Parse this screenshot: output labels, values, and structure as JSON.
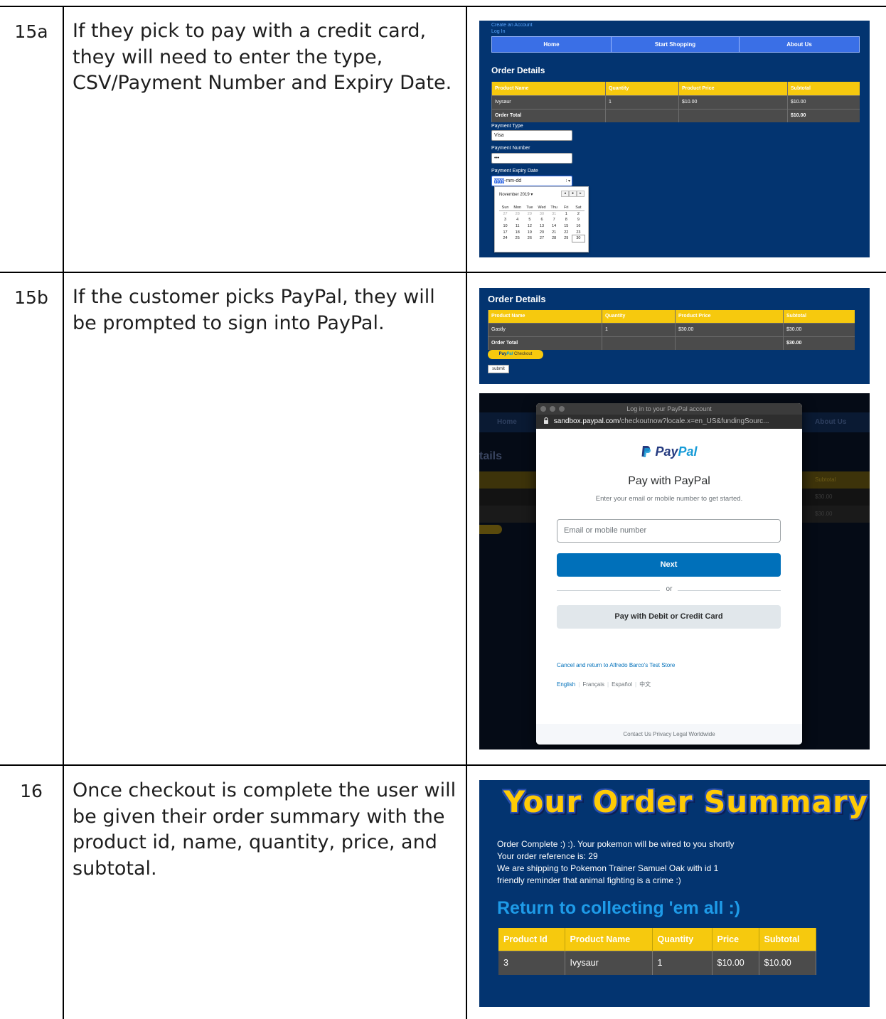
{
  "rows": [
    {
      "num": "15a",
      "text": "If they pick to pay with a credit card, they will need to enter the type, CSV/Payment Number and Expiry Date."
    },
    {
      "num": "15b",
      "text": "If the customer picks PayPal, they will be prompted to sign into PayPal."
    },
    {
      "num": "16",
      "text": "Once checkout is complete the user will be given their order summary with the product id, name, quantity, price, and subtotal."
    }
  ],
  "shot_a": {
    "links": [
      "Create an Account",
      "Log In"
    ],
    "nav": [
      "Home",
      "Start Shopping",
      "About Us"
    ],
    "title": "Order Details",
    "table": {
      "headers": [
        "Product Name",
        "Quantity",
        "Product Price",
        "Subtotal"
      ],
      "row": [
        "Ivysaur",
        "1",
        "$10.00",
        "$10.00"
      ],
      "total_label": "Order Total",
      "total_value": "$10.00"
    },
    "payment_type_label": "Payment Type",
    "payment_type_value": "Visa",
    "payment_number_label": "Payment Number",
    "payment_number_value": "•••",
    "expiry_label": "Payment Expiry Date",
    "expiry_sel": "yyyy",
    "expiry_rest": "-mm-dd",
    "calendar": {
      "month": "November 2019 ▾",
      "dow": [
        "Sun",
        "Mon",
        "Tue",
        "Wed",
        "Thu",
        "Fri",
        "Sat"
      ],
      "weeks": [
        [
          "27",
          "28",
          "29",
          "30",
          "31",
          "1",
          "2"
        ],
        [
          "3",
          "4",
          "5",
          "6",
          "7",
          "8",
          "9"
        ],
        [
          "10",
          "11",
          "12",
          "13",
          "14",
          "15",
          "16"
        ],
        [
          "17",
          "18",
          "19",
          "20",
          "21",
          "22",
          "23"
        ],
        [
          "24",
          "25",
          "26",
          "27",
          "28",
          "29",
          "30"
        ]
      ]
    }
  },
  "shot_b": {
    "title": "Order Details",
    "table": {
      "headers": [
        "Product Name",
        "Quantity",
        "Product Price",
        "Subtotal"
      ],
      "row": [
        "Gastly",
        "1",
        "$30.00",
        "$30.00"
      ],
      "total_label": "Order Total",
      "total_value": "$30.00"
    },
    "paypal_button_a": "Pay",
    "paypal_button_b": "Pal",
    "paypal_button_c": "Checkout",
    "submit": "submit"
  },
  "shot_c": {
    "bg_nav": [
      "Home",
      "About Us"
    ],
    "bg_title": "tails",
    "bg_subtotal": "Subtotal",
    "bg_values": [
      "$30.00",
      "$30.00"
    ],
    "window_title": "Log in to your PayPal account",
    "url_host": "sandbox.paypal.com",
    "url_path": "/checkoutnow?locale.x=en_US&fundingSourc...",
    "logo_a": "Pay",
    "logo_b": "Pal",
    "heading": "Pay with PayPal",
    "subheading": "Enter your email or mobile number to get started.",
    "email_placeholder": "Email or mobile number",
    "next": "Next",
    "or": "or",
    "card": "Pay with Debit or Credit Card",
    "cancel": "Cancel and return to Alfredo Barco's Test Store",
    "langs": [
      "English",
      "Français",
      "Español",
      "中文"
    ],
    "footer": [
      "Contact Us",
      "Privacy",
      "Legal",
      "Worldwide"
    ]
  },
  "shot_d": {
    "title": "Your Order Summary",
    "lines": [
      "Order Complete :) :). Your pokemon will be wired to you shortly",
      "Your order reference is: 29",
      "We are shipping to Pokemon Trainer Samuel Oak with id 1",
      "friendly reminder that animal fighting is a crime :)"
    ],
    "return_link": "Return to collecting 'em all :)",
    "table": {
      "headers": [
        "Product Id",
        "Product Name",
        "Quantity",
        "Price",
        "Subtotal"
      ],
      "row": [
        "3",
        "Ivysaur",
        "1",
        "$10.00",
        "$10.00"
      ]
    }
  },
  "colors": {
    "navy": "#033470",
    "gold": "#f6c90e",
    "paypal_blue": "#0070ba"
  }
}
